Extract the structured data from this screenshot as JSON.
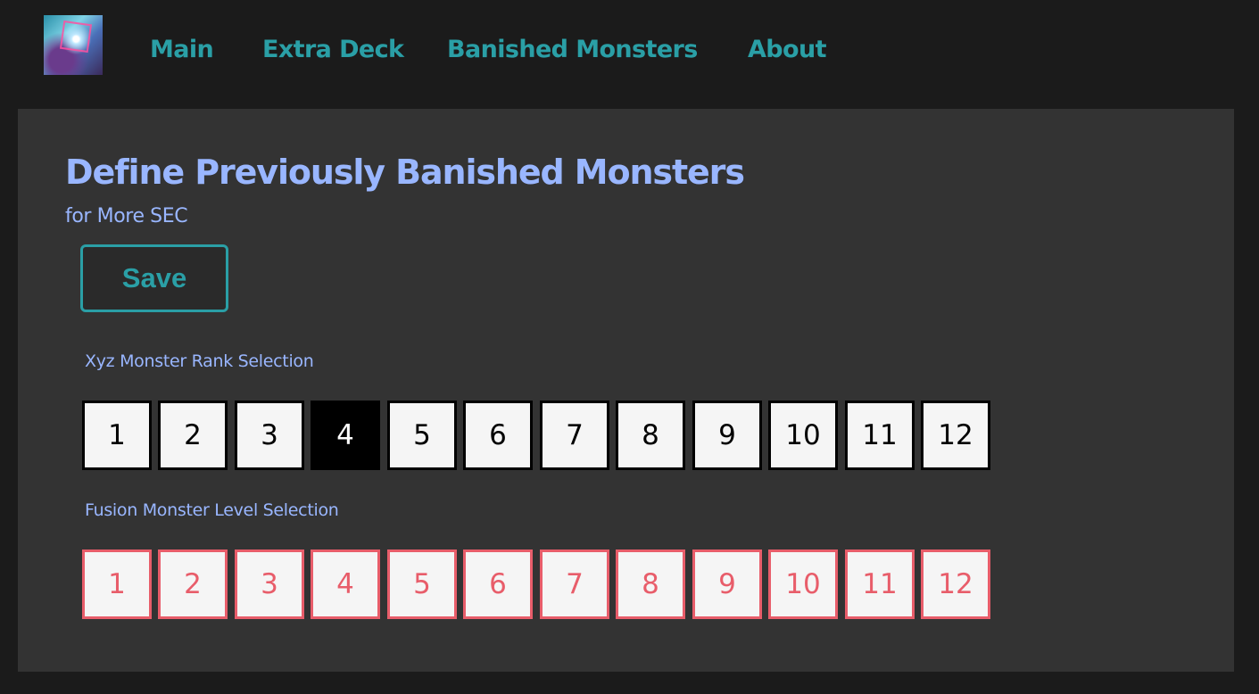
{
  "nav": {
    "logo_alt": "logo",
    "links": [
      {
        "label": "Main"
      },
      {
        "label": "Extra Deck"
      },
      {
        "label": "Banished Monsters"
      },
      {
        "label": "About"
      }
    ]
  },
  "main": {
    "title": "Define Previously Banished Monsters",
    "subtitle": "for More SEC",
    "save_label": "Save"
  },
  "xyz": {
    "label": "Xyz Monster Rank Selection",
    "options": [
      "1",
      "2",
      "3",
      "4",
      "5",
      "6",
      "7",
      "8",
      "9",
      "10",
      "11",
      "12"
    ],
    "selected": "4"
  },
  "fusion": {
    "label": "Fusion Monster Level Selection",
    "options": [
      "1",
      "2",
      "3",
      "4",
      "5",
      "6",
      "7",
      "8",
      "9",
      "10",
      "11",
      "12"
    ]
  },
  "colors": {
    "accent": "#2a9fa6",
    "title": "#99b6ff",
    "fusion": "#e85d6a",
    "background": "#1b1b1b",
    "panel": "#333333"
  }
}
